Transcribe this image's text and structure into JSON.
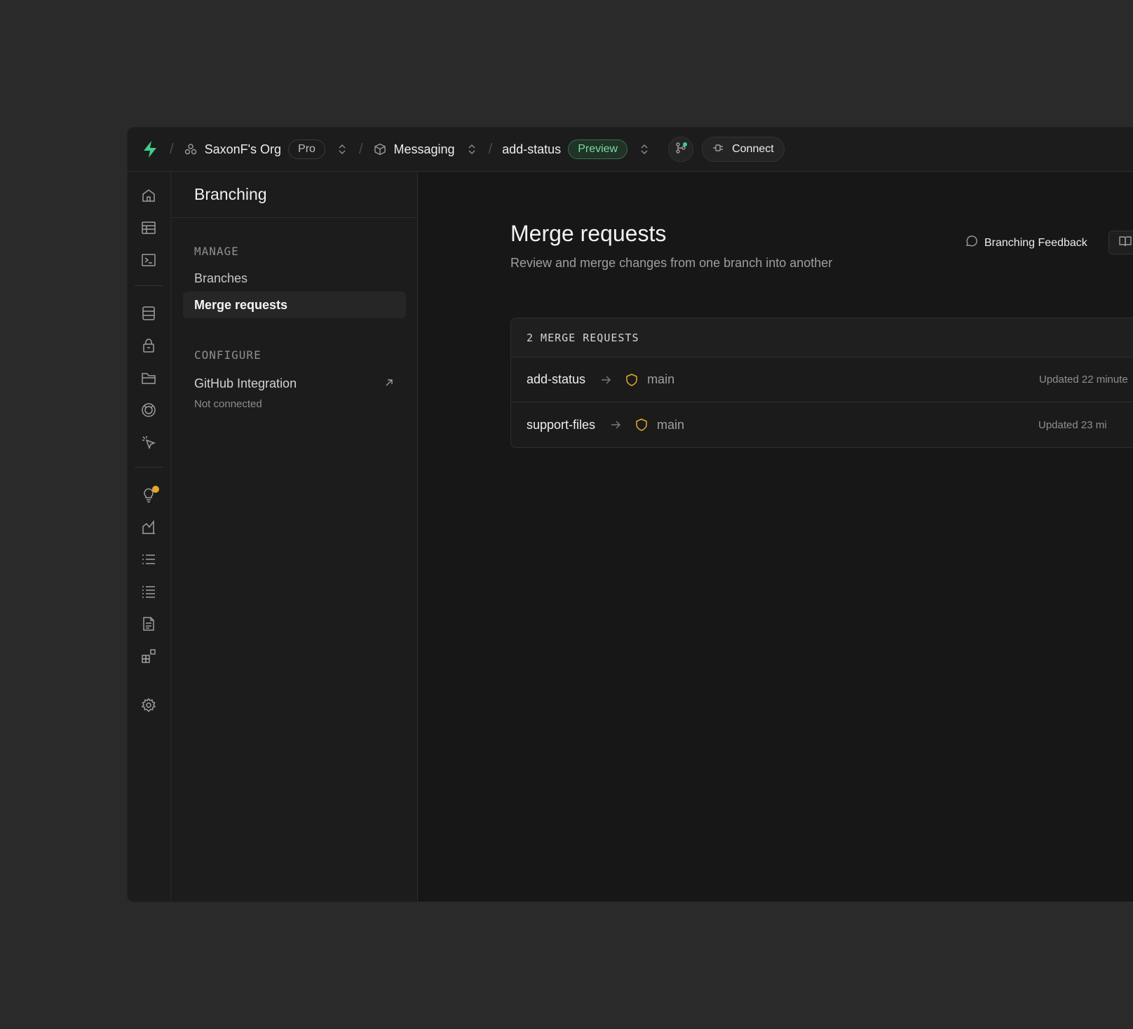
{
  "topbar": {
    "org_name": "SaxonF's Org",
    "plan_badge": "Pro",
    "project_name": "Messaging",
    "branch_name": "add-status",
    "branch_badge": "Preview",
    "connect_label": "Connect"
  },
  "menu": {
    "title": "Branching",
    "section_manage": "MANAGE",
    "items": [
      {
        "label": "Branches",
        "active": false
      },
      {
        "label": "Merge requests",
        "active": true
      }
    ],
    "section_configure": "CONFIGURE",
    "github": {
      "title": "GitHub Integration",
      "status": "Not connected"
    }
  },
  "main": {
    "title": "Merge requests",
    "subtitle": "Review and merge changes from one branch into another",
    "feedback_label": "Branching Feedback",
    "list_header": "2 MERGE REQUESTS",
    "merge_requests": [
      {
        "source": "add-status",
        "target": "main",
        "updated": "Updated 22 minute"
      },
      {
        "source": "support-files",
        "target": "main",
        "updated": "Updated 23 mi"
      }
    ]
  },
  "colors": {
    "brand_green": "#3ecf8e",
    "warning_amber": "#e7a92a",
    "background": "#171717"
  }
}
